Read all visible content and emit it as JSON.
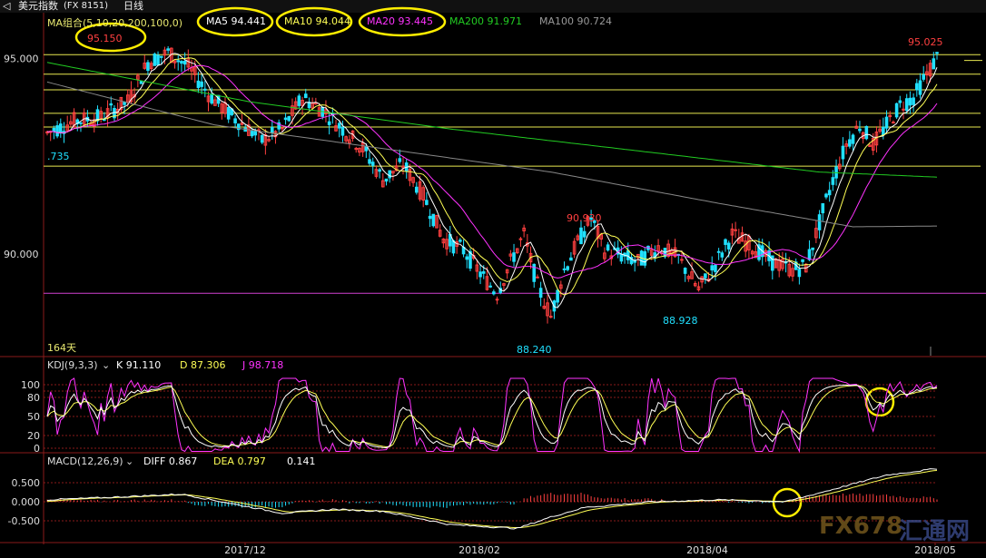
{
  "window": {
    "title": "美元指数",
    "code": "(FX 8151)",
    "period": "日线"
  },
  "legend_main": {
    "ma_group": "MA组合(5,10,20,200,100,0)",
    "ma5": "MA5 94.441",
    "ma10": "MA10 94.044",
    "ma20": "MA20 93.445",
    "ma200": "MA200 91.971",
    "ma100": "MA100 90.724"
  },
  "legend_kdj": {
    "title": "KDJ(9,3,3)",
    "k": "K 91.110",
    "d": "D 87.306",
    "j": "J 98.718"
  },
  "legend_macd": {
    "title": "MACD(12,26,9)",
    "diff": "DIFF 0.867",
    "dea": "DEA 0.797",
    "macd": "0.141"
  },
  "watermark": {
    "brand": "FX678",
    "cn": "汇通网"
  },
  "colors": {
    "up": "#ff4040",
    "down": "#20e0ff",
    "ma5": "#ffffff",
    "ma10": "#ffff55",
    "ma20": "#ff33ff",
    "ma200": "#22cc22",
    "ma100": "#888888",
    "hline": "#e8e850",
    "support": "#d040d0",
    "grid": "#8a1a1a",
    "circle": "#ffee00"
  },
  "chart_data": {
    "type": "candlestick",
    "x_ticks": [
      "2017/12",
      "2018/02",
      "2018/04",
      "2018/05"
    ],
    "y_ticks_main": [
      "95.000",
      "90.000"
    ],
    "y_ticks_kdj": [
      "100",
      "80",
      "50",
      "20",
      "0"
    ],
    "y_ticks_macd": [
      "0.500",
      "0.000",
      "-0.500"
    ],
    "ylim_main": [
      87.5,
      95.8
    ],
    "annotations": {
      "high1": "95.150",
      "high2": "95.025",
      "mid_high": "90.930",
      "low1": "88.240",
      "low2": "88.928",
      "left_edge": ".735",
      "days": "164天"
    },
    "horizontal_levels": [
      95.1,
      94.6,
      94.2,
      93.6,
      93.25,
      92.25
    ],
    "support_level": 89.0,
    "price_path": [
      [
        0,
        93.1
      ],
      [
        8,
        93.4
      ],
      [
        16,
        93.5
      ],
      [
        24,
        93.9
      ],
      [
        30,
        94.9
      ],
      [
        36,
        95.15
      ],
      [
        42,
        94.8
      ],
      [
        48,
        94.1
      ],
      [
        54,
        93.6
      ],
      [
        60,
        93.2
      ],
      [
        64,
        92.9
      ],
      [
        70,
        93.2
      ],
      [
        76,
        94.0
      ],
      [
        82,
        93.7
      ],
      [
        88,
        93.2
      ],
      [
        94,
        92.7
      ],
      [
        100,
        91.9
      ],
      [
        106,
        92.3
      ],
      [
        112,
        91.5
      ],
      [
        118,
        90.4
      ],
      [
        124,
        90.1
      ],
      [
        130,
        89.4
      ],
      [
        134,
        89.0
      ],
      [
        138,
        89.8
      ],
      [
        142,
        90.5
      ],
      [
        146,
        89.2
      ],
      [
        150,
        88.4
      ],
      [
        154,
        89.6
      ],
      [
        158,
        90.3
      ],
      [
        162,
        90.93
      ],
      [
        166,
        90.1
      ],
      [
        170,
        90.0
      ],
      [
        176,
        89.8
      ],
      [
        182,
        90.2
      ],
      [
        188,
        89.9
      ],
      [
        194,
        89.1
      ],
      [
        198,
        89.6
      ],
      [
        204,
        90.5
      ],
      [
        210,
        90.2
      ],
      [
        216,
        89.8
      ],
      [
        222,
        89.6
      ],
      [
        226,
        89.7
      ],
      [
        230,
        90.8
      ],
      [
        234,
        91.9
      ],
      [
        238,
        92.8
      ],
      [
        242,
        93.3
      ],
      [
        246,
        92.8
      ],
      [
        250,
        93.3
      ],
      [
        254,
        93.8
      ],
      [
        258,
        94.0
      ],
      [
        262,
        94.6
      ],
      [
        265,
        95.025
      ]
    ],
    "ma_anchors": {
      "ma200": [
        [
          0,
          94.9
        ],
        [
          60,
          93.9
        ],
        [
          120,
          93.2
        ],
        [
          180,
          92.6
        ],
        [
          230,
          92.1
        ],
        [
          265,
          91.97
        ]
      ],
      "ma100": [
        [
          0,
          94.4
        ],
        [
          50,
          93.3
        ],
        [
          100,
          92.7
        ],
        [
          150,
          92.1
        ],
        [
          200,
          91.3
        ],
        [
          240,
          90.7
        ],
        [
          265,
          90.72
        ]
      ]
    },
    "macd_path": [
      [
        0,
        0.05
      ],
      [
        20,
        0.12
      ],
      [
        40,
        0.2
      ],
      [
        55,
        -0.05
      ],
      [
        70,
        -0.3
      ],
      [
        85,
        -0.2
      ],
      [
        100,
        -0.25
      ],
      [
        120,
        -0.6
      ],
      [
        140,
        -0.7
      ],
      [
        150,
        -0.4
      ],
      [
        160,
        -0.15
      ],
      [
        180,
        0.0
      ],
      [
        200,
        0.05
      ],
      [
        220,
        0.0
      ],
      [
        235,
        0.35
      ],
      [
        250,
        0.7
      ],
      [
        265,
        0.87
      ]
    ]
  }
}
